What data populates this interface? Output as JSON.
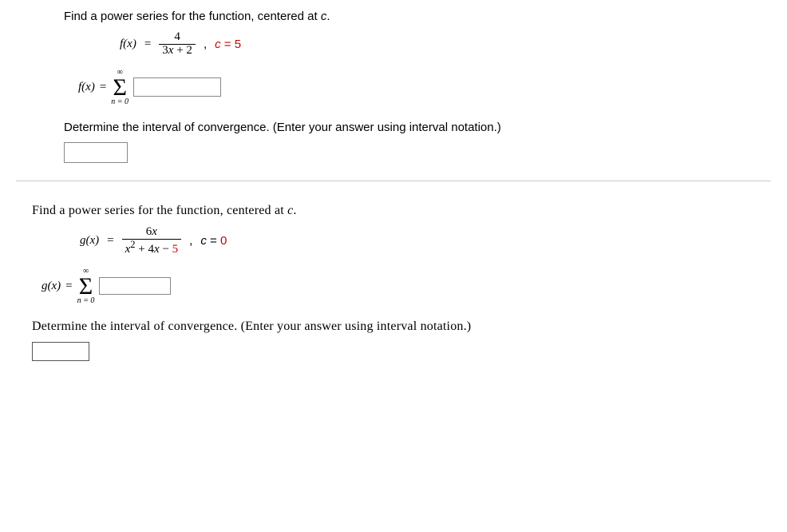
{
  "q1": {
    "prompt": "Find a power series for the function, centered at c.",
    "fn_label": "f(x)",
    "frac_num": "4",
    "frac_den": "3x + 2",
    "c_label": "c = 5",
    "sum_fn_label": "f(x)",
    "sum_top": "∞",
    "sigma": "Σ",
    "sum_bot": "n = 0",
    "sub_prompt": "Determine the interval of convergence. (Enter your answer using interval notation.)"
  },
  "q2": {
    "prompt": "Find a power series for the function, centered at c.",
    "fn_label": "g(x)",
    "frac_num": "6x",
    "frac_den_prefix": "x",
    "frac_den_exp": "2",
    "frac_den_rest": " + 4x − 5",
    "c_label": "c = 0",
    "sum_fn_label": "g(x)",
    "sum_top": "∞",
    "sigma": "Σ",
    "sum_bot": "n = 0",
    "sub_prompt": "Determine the interval of convergence. (Enter your answer using interval notation.)"
  }
}
